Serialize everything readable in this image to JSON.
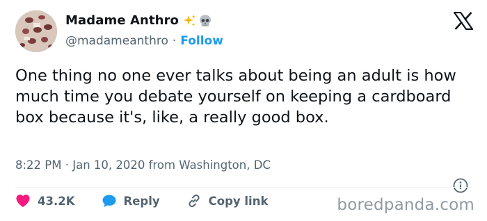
{
  "author": {
    "display_name": "Madame Anthro",
    "handle": "@madameanthro",
    "separator": "·",
    "follow_label": "Follow",
    "emojis": [
      "sparkles-icon",
      "skull-icon"
    ]
  },
  "tweet": {
    "text": "One thing no one ever talks about being an adult is how much time you debate yourself on keeping a cardboard box because it's, like, a really good box.",
    "timestamp": "8:22 PM · Jan 10, 2020 from Washington, DC"
  },
  "actions": {
    "likes_count": "43.2K",
    "reply_label": "Reply",
    "copy_link_label": "Copy link"
  },
  "watermark": "boredpanda.com",
  "colors": {
    "accent": "#1d9bf0",
    "heart": "#f91880",
    "text": "#0f1419",
    "muted": "#536471"
  }
}
